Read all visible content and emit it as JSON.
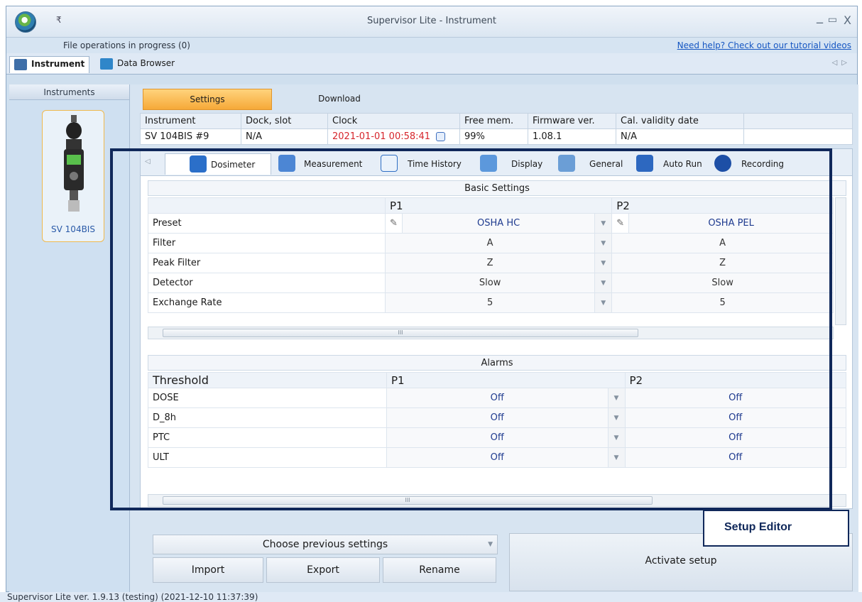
{
  "window": {
    "title": "Supervisor Lite - Instrument",
    "minimize": "_",
    "maximize": "▭",
    "close": "X",
    "qat": "₹"
  },
  "infobar": {
    "file_ops": "File operations in progress (0)",
    "help_link": "Need help? Check out our tutorial videos"
  },
  "nav_tabs": [
    {
      "label": "Instrument"
    },
    {
      "label": "Data Browser"
    }
  ],
  "left_panel": {
    "header": "Instruments",
    "device_label": "SV 104BIS"
  },
  "sub_tabs": {
    "settings": "Settings",
    "download": "Download"
  },
  "instrument_table": {
    "headers": [
      "Instrument",
      "Dock, slot",
      "Clock",
      "Free mem.",
      "Firmware ver.",
      "Cal. validity date"
    ],
    "row": [
      "SV 104BIS #9",
      "N/A",
      "2021-01-01 00:58:41",
      "99%",
      "1.08.1",
      "N/A"
    ]
  },
  "editor_tabs": [
    "Dosimeter",
    "Measurement",
    "Time History",
    "Display",
    "General",
    "Auto Run",
    "Recording"
  ],
  "editor_tab_icons": [
    "headphones-icon",
    "waveform-icon",
    "chart-icon",
    "display-icon",
    "gears-icon",
    "play-icon",
    "rec-icon"
  ],
  "basic_settings": {
    "title": "Basic Settings",
    "col_p1": "P1",
    "col_p2": "P2",
    "rows": [
      {
        "label": "Preset",
        "p1": "OSHA HC",
        "p2": "OSHA PEL"
      },
      {
        "label": "Filter",
        "p1": "A",
        "p2": "A"
      },
      {
        "label": "Peak Filter",
        "p1": "Z",
        "p2": "Z"
      },
      {
        "label": "Detector",
        "p1": "Slow",
        "p2": "Slow"
      },
      {
        "label": "Exchange Rate",
        "p1": "5",
        "p2": "5"
      }
    ]
  },
  "alarms": {
    "title": "Alarms",
    "col_threshold": "Threshold",
    "col_p1": "P1",
    "col_p2": "P2",
    "rows": [
      {
        "label": "DOSE",
        "p1": "Off",
        "p2": "Off"
      },
      {
        "label": "D_8h",
        "p1": "Off",
        "p2": "Off"
      },
      {
        "label": "PTC",
        "p1": "Off",
        "p2": "Off"
      },
      {
        "label": "ULT",
        "p1": "Off",
        "p2": "Off"
      }
    ]
  },
  "scroll_thumb": "III",
  "callout": "Setup Editor",
  "bottom": {
    "choose_prev": "Choose previous settings",
    "import": "Import",
    "export": "Export",
    "rename": "Rename",
    "activate": "Activate setup"
  },
  "status": "Supervisor Lite ver. 1.9.13 (testing) (2021-12-10 11:37:39)",
  "colors": {
    "accent_orange": "#f6a938",
    "clock_red": "#d6252b",
    "focus_navy": "#10285a",
    "link_blue": "#1556c2"
  }
}
